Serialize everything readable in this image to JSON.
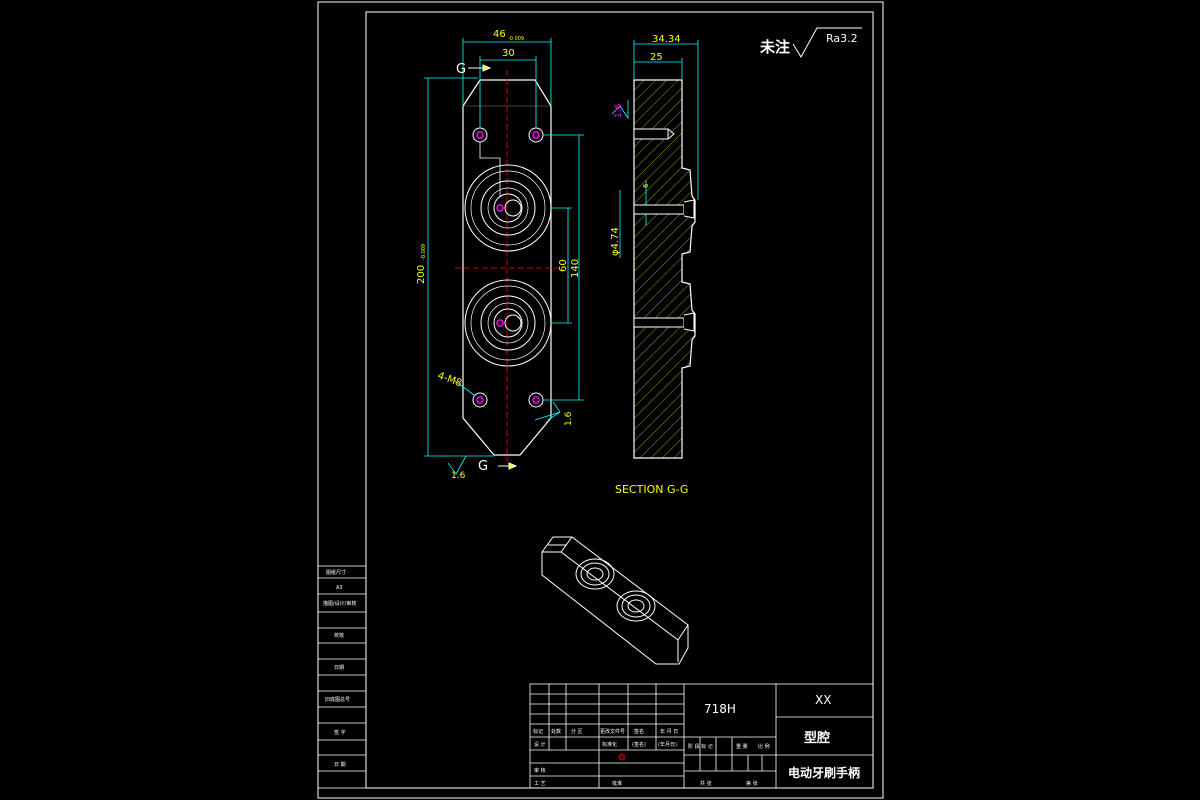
{
  "colors": {
    "frame": "#ffffff",
    "outline": "#ffffff",
    "dimension": "#00ffff",
    "dim_text": "#ffff00",
    "centerline": "#ff0000",
    "hatch": "#ffff00",
    "hole_mark": "#ff00ff",
    "title_text": "#ffffff"
  },
  "roughness": {
    "label": "未注",
    "value": "Ra3.2"
  },
  "front_view": {
    "dims": {
      "width_top": "46",
      "width_top_tol": "-0.009",
      "width_inner": "30",
      "height": "200",
      "height_tol": "-0.009",
      "spacing_140": "140",
      "spacing_60": "60",
      "hole_note": "4-M8",
      "rough_bottom": "1.6",
      "rough_right": "1.6"
    },
    "section_letters": {
      "top": "G",
      "bottom": "G"
    }
  },
  "section_view": {
    "dims": {
      "width_total": "34.34",
      "width_inner": "25",
      "rough_left": "1.6",
      "hole_dia": "φ4.74",
      "small": "6"
    },
    "caption": "SECTION G-G"
  },
  "left_table": {
    "rows": [
      "图纸尺寸",
      "A3",
      "描图/设计/审核",
      "校核",
      "日期",
      "旧底图总号",
      "签 字",
      "日 期"
    ]
  },
  "title_block": {
    "material": "718H",
    "company": "XX",
    "part_type": "型腔",
    "product": "电动牙刷手柄",
    "header_cells": [
      "标记",
      "处数",
      "分 区",
      "更改文件号",
      "签名",
      "年 月 日"
    ],
    "left_labels": [
      "设 计",
      "审 核",
      "工 艺"
    ],
    "mid_labels": [
      "标准化",
      "(签名)",
      "(年月日)"
    ],
    "approve": "批准",
    "stage_labels": [
      "阶 段 标 记",
      "重 量",
      "比 例"
    ],
    "sheet_labels": [
      "共 张",
      "第 张"
    ]
  }
}
